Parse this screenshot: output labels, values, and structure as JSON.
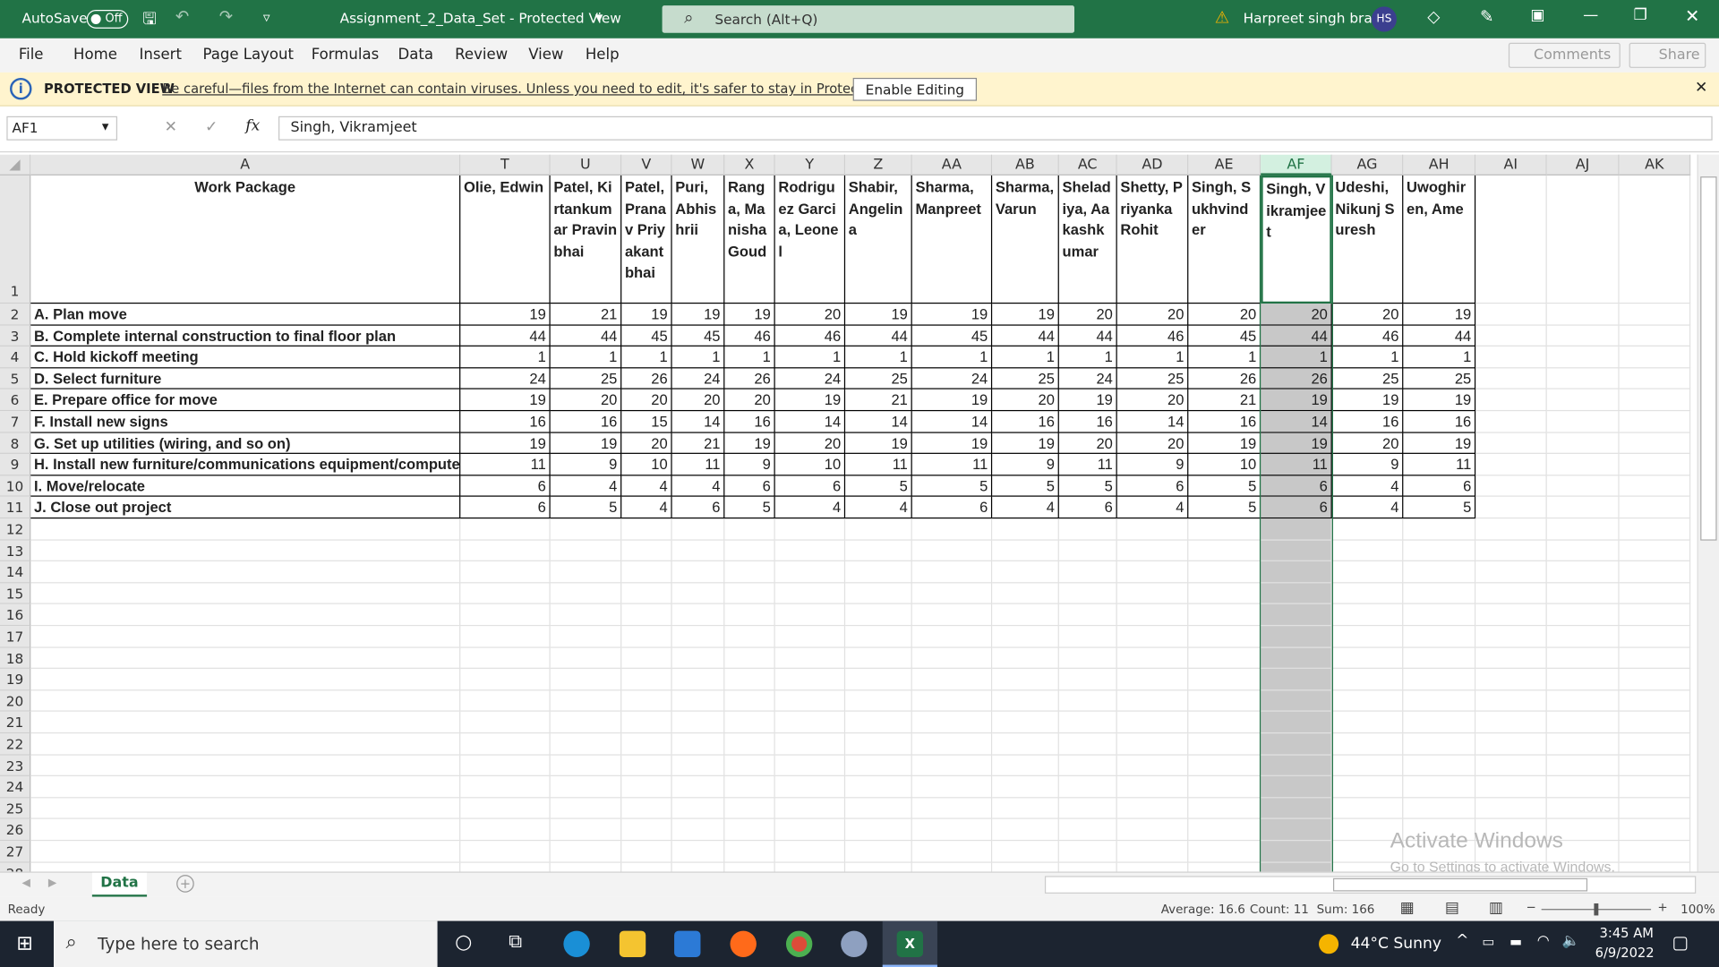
{
  "titlebar": {
    "autosave_label": "AutoSave",
    "autosave_state": "Off",
    "doc_title": "Assignment_2_Data_Set  -  Protected View",
    "search_placeholder": "Search (Alt+Q)",
    "user_name": "Harpreet singh brar",
    "user_initials": "HS"
  },
  "menu": {
    "items": [
      "File",
      "Home",
      "Insert",
      "Page Layout",
      "Formulas",
      "Data",
      "Review",
      "View",
      "Help"
    ],
    "comments": "Comments",
    "share": "Share"
  },
  "protected_view": {
    "label": "PROTECTED VIEW",
    "message": "Be careful—files from the Internet can contain viruses. Unless you need to edit, it's safer to stay in Protected View.",
    "button": "Enable Editing"
  },
  "formula_bar": {
    "name_box": "AF1",
    "fx": "fx",
    "value": "Singh, Vikramjeet"
  },
  "sheet": {
    "columns": [
      "A",
      "T",
      "U",
      "V",
      "W",
      "X",
      "Y",
      "Z",
      "AA",
      "AB",
      "AC",
      "AD",
      "AE",
      "AF",
      "AG",
      "AH",
      "AI",
      "AJ",
      "AK"
    ],
    "selected_column": "AF",
    "header_a": "Work Package",
    "names": [
      "Olie, Edwin",
      "Patel, Kirtankumar Pravinbhai",
      "Patel, Pranav Priyakantbhai",
      "Puri, Abhishrii",
      "Ranga, Manisha Goud",
      "Rodriguez Garcia, Leonel",
      "Shabir, Angelina",
      "Sharma, Manpreet",
      "Sharma, Varun",
      "Sheladiya, Aakashkumar",
      "Shetty, Priyanka Rohit",
      "Singh, Sukhvinder",
      "Singh, Vikramjeet",
      "Udeshi, Nikunj Suresh",
      "Uwoghiren, Ame"
    ],
    "rows": [
      {
        "label": "A. Plan move",
        "values": [
          19,
          21,
          19,
          19,
          19,
          20,
          19,
          19,
          19,
          20,
          20,
          20,
          20,
          20,
          19
        ]
      },
      {
        "label": "B. Complete internal construction to final floor plan",
        "values": [
          44,
          44,
          45,
          45,
          46,
          46,
          44,
          45,
          44,
          44,
          46,
          45,
          44,
          46,
          44
        ]
      },
      {
        "label": "C. Hold kickoff meeting",
        "values": [
          1,
          1,
          1,
          1,
          1,
          1,
          1,
          1,
          1,
          1,
          1,
          1,
          1,
          1,
          1
        ]
      },
      {
        "label": "D. Select furniture",
        "values": [
          24,
          25,
          26,
          24,
          26,
          24,
          25,
          24,
          25,
          24,
          25,
          26,
          26,
          25,
          25
        ]
      },
      {
        "label": "E. Prepare office for move",
        "values": [
          19,
          20,
          20,
          20,
          20,
          19,
          21,
          19,
          20,
          19,
          20,
          21,
          19,
          19,
          19
        ]
      },
      {
        "label": "F. Install new signs",
        "values": [
          16,
          16,
          15,
          14,
          16,
          14,
          14,
          14,
          16,
          16,
          14,
          16,
          14,
          16,
          16
        ]
      },
      {
        "label": "G. Set up utilities (wiring, and so on)",
        "values": [
          19,
          19,
          20,
          21,
          19,
          20,
          19,
          19,
          19,
          20,
          20,
          19,
          19,
          20,
          19
        ]
      },
      {
        "label": "H. Install new furniture/communications equipment/computers",
        "values": [
          11,
          9,
          10,
          11,
          9,
          10,
          11,
          11,
          9,
          11,
          9,
          10,
          11,
          9,
          11
        ]
      },
      {
        "label": "I. Move/relocate",
        "values": [
          6,
          4,
          4,
          4,
          6,
          6,
          5,
          5,
          5,
          5,
          6,
          5,
          6,
          4,
          6
        ]
      },
      {
        "label": "J. Close out project",
        "values": [
          6,
          5,
          4,
          6,
          5,
          4,
          4,
          6,
          4,
          6,
          4,
          5,
          6,
          4,
          5
        ]
      }
    ],
    "tab": "Data"
  },
  "status": {
    "ready": "Ready",
    "average": "Average: 16.6",
    "count": "Count: 11",
    "sum": "Sum: 166",
    "zoom": "100%"
  },
  "watermark": {
    "line1": "Activate Windows",
    "line2": "Go to Settings to activate Windows."
  },
  "taskbar": {
    "search_placeholder": "Type here to search",
    "weather": "44°C  Sunny",
    "time": "3:45 AM",
    "date": "6/9/2022"
  },
  "colors": {
    "excel_green": "#217346",
    "protected_bar": "#fff4ce",
    "selection_fill": "#c8c8c8"
  }
}
